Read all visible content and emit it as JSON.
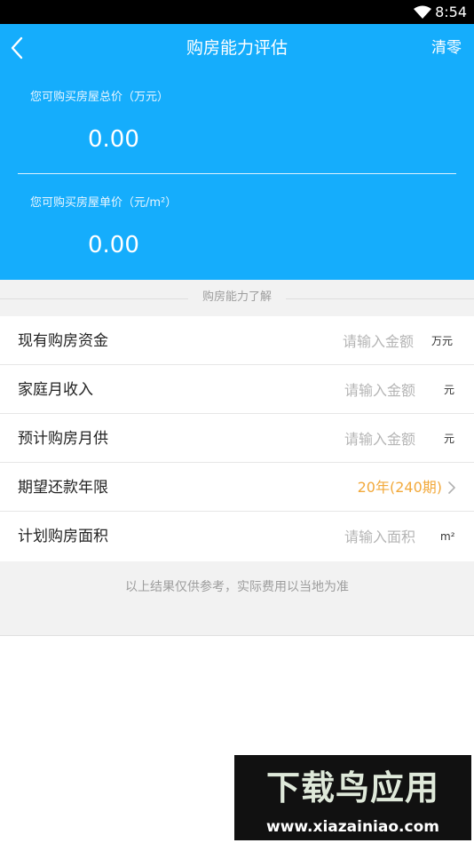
{
  "status_bar": {
    "time": "8:54"
  },
  "header": {
    "back_icon": "chevron-left-icon",
    "title": "购房能力评估",
    "clear_label": "清零",
    "background_color": "#15adfc"
  },
  "results": [
    {
      "label": "您可购买房屋总价（万元）",
      "value": "0.00"
    },
    {
      "label": "您可购买房屋单价（元/m²）",
      "value": "0.00"
    }
  ],
  "section": {
    "title": "购房能力了解"
  },
  "form": {
    "rows": [
      {
        "label": "现有购房资金",
        "placeholder": "请输入金额",
        "value": "",
        "unit": "万元"
      },
      {
        "label": "家庭月收入",
        "placeholder": "请输入金额",
        "value": "",
        "unit": "元"
      },
      {
        "label": "预计购房月供",
        "placeholder": "请输入金额",
        "value": "",
        "unit": "元"
      },
      {
        "label": "期望还款年限",
        "selected": "20年(240期)",
        "icon": "chevron-right-icon",
        "accent_color": "#f2a93b"
      },
      {
        "label": "计划购房面积",
        "placeholder": "请输入面积",
        "value": "",
        "unit": "m²"
      }
    ]
  },
  "footer": {
    "note": "以上结果仅供参考，实际费用以当地为准"
  },
  "watermark": {
    "logo_text": "下载鸟应用",
    "url": "www.xiazainiao.com"
  }
}
